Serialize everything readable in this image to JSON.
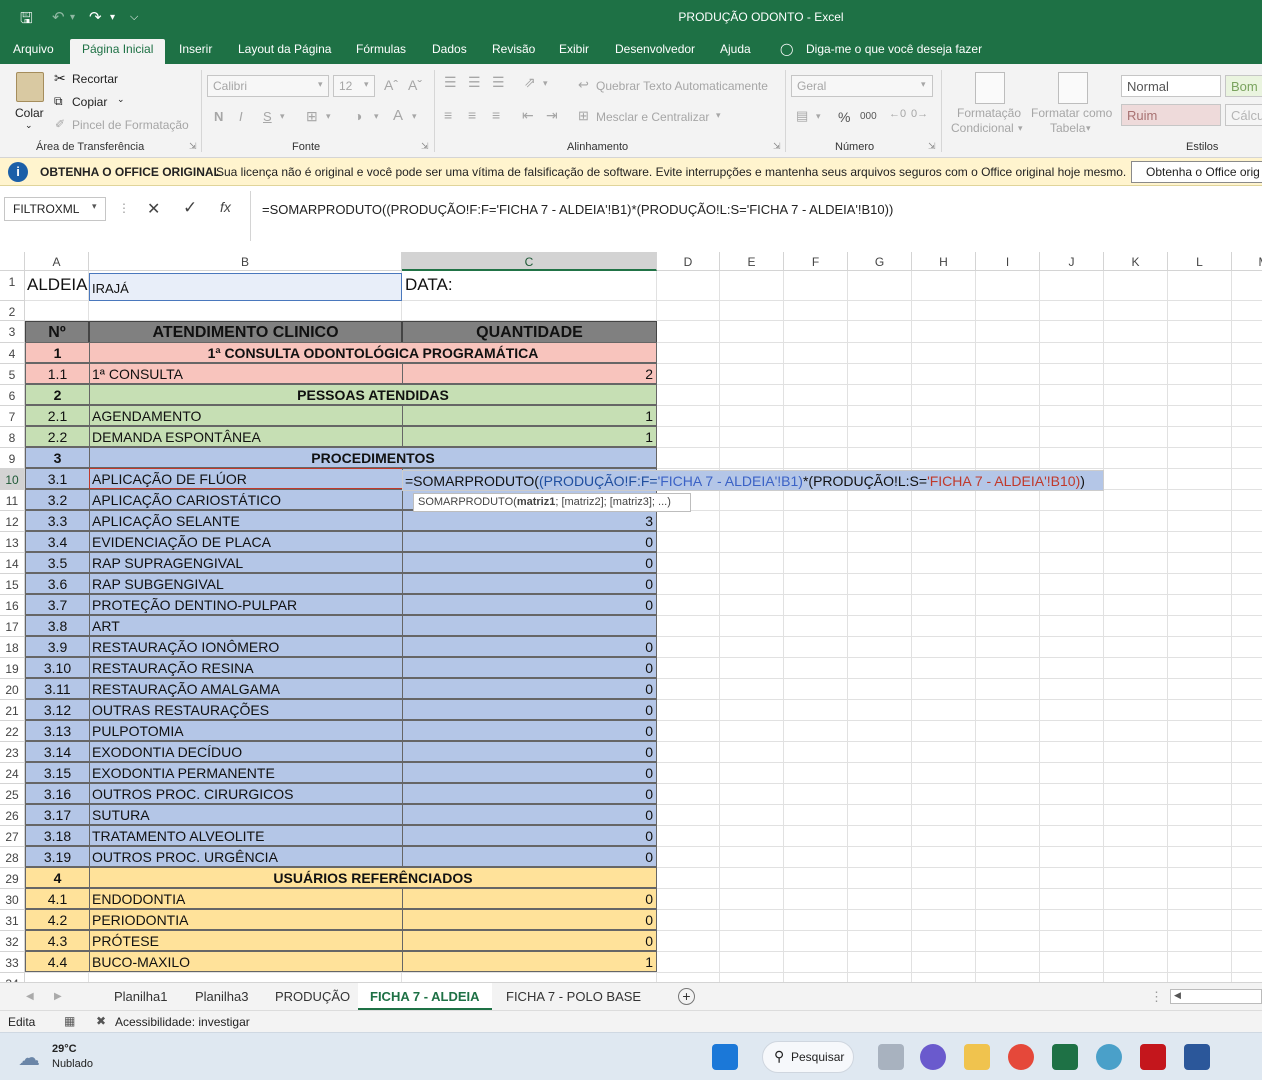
{
  "window": {
    "title": "PRODUÇÃO ODONTO  -  Excel"
  },
  "quick_access": {
    "save_icon": "save-icon",
    "undo_icon": "undo-icon",
    "redo_icon": "redo-icon"
  },
  "menu": {
    "tabs": [
      "Arquivo",
      "Página Inicial",
      "Inserir",
      "Layout da Página",
      "Fórmulas",
      "Dados",
      "Revisão",
      "Exibir",
      "Desenvolvedor",
      "Ajuda"
    ],
    "tell_me": "Diga-me o que você deseja fazer"
  },
  "ribbon": {
    "clipboard": {
      "paste": "Colar",
      "cut": "Recortar",
      "copy": "Copiar",
      "format_painter": "Pincel de Formatação",
      "label": "Área de Transferência"
    },
    "font": {
      "name": "Calibri",
      "size": "12",
      "label": "Fonte",
      "bold": "N",
      "italic": "I",
      "underline": "S"
    },
    "alignment": {
      "wrap": "Quebrar Texto Automaticamente",
      "merge": "Mesclar e Centralizar",
      "label": "Alinhamento"
    },
    "number": {
      "format": "Geral",
      "label": "Número",
      "percent": "%",
      "thousands": "000"
    },
    "styles": {
      "conditional": "Formatação",
      "conditional2": "Condicional",
      "table": "Formatar como",
      "table2": "Tabela",
      "normal": "Normal",
      "bom": "Bom",
      "ruim": "Ruim",
      "calculo": "Cálcu",
      "label": "Estilos"
    }
  },
  "message_bar": {
    "title": "OBTENHA O OFFICE ORIGINAL",
    "text": "Sua licença não é original e você pode ser uma vítima de falsificação de software. Evite interrupções e mantenha seus arquivos seguros com o Office original hoje mesmo.",
    "button": "Obtenha o Office orig"
  },
  "formula_bar": {
    "name_box": "FILTROXML",
    "formula": "=SOMARPRODUTO((PRODUÇÃO!F:F='FICHA 7 - ALDEIA'!B1)*(PRODUÇÃO!L:S='FICHA 7 - ALDEIA'!B10))"
  },
  "columns": [
    "A",
    "B",
    "C",
    "D",
    "E",
    "F",
    "G",
    "H",
    "I",
    "J",
    "K",
    "L",
    "M"
  ],
  "sheet": {
    "r1": {
      "a": "ALDEIA:",
      "b": "IRAJÁ",
      "c": "DATA:"
    },
    "header": {
      "a": "Nº",
      "b": "ATENDIMENTO CLINICO",
      "c": "QUANTIDADE"
    },
    "rows": [
      {
        "n": "4",
        "a": "1",
        "b": "1ª CONSULTA ODONTOLÓGICA PROGRAMÁTICA",
        "c": "",
        "section": true
      },
      {
        "n": "5",
        "a": "1.1",
        "b": "1ª CONSULTA",
        "c": "2"
      },
      {
        "n": "6",
        "a": "2",
        "b": "PESSOAS ATENDIDAS",
        "c": "",
        "section": true
      },
      {
        "n": "7",
        "a": "2.1",
        "b": "AGENDAMENTO",
        "c": "1"
      },
      {
        "n": "8",
        "a": "2.2",
        "b": "DEMANDA ESPONTÂNEA",
        "c": "1"
      },
      {
        "n": "9",
        "a": "3",
        "b": "PROCEDIMENTOS",
        "c": "",
        "section": true
      },
      {
        "n": "10",
        "a": "3.1",
        "b": "APLICAÇÃO DE FLÚOR",
        "c": ""
      },
      {
        "n": "11",
        "a": "3.2",
        "b": "APLICAÇÃO CARIOSTÁTICO",
        "c": ""
      },
      {
        "n": "12",
        "a": "3.3",
        "b": "APLICAÇÃO SELANTE",
        "c": "3"
      },
      {
        "n": "13",
        "a": "3.4",
        "b": "EVIDENCIAÇÃO DE PLACA",
        "c": "0"
      },
      {
        "n": "14",
        "a": "3.5",
        "b": "RAP SUPRAGENGIVAL",
        "c": "0"
      },
      {
        "n": "15",
        "a": "3.6",
        "b": "RAP SUBGENGIVAL",
        "c": "0"
      },
      {
        "n": "16",
        "a": "3.7",
        "b": "PROTEÇÃO DENTINO-PULPAR",
        "c": "0"
      },
      {
        "n": "17",
        "a": "3.8",
        "b": "ART",
        "c": ""
      },
      {
        "n": "18",
        "a": "3.9",
        "b": "RESTAURAÇÃO IONÔMERO",
        "c": "0"
      },
      {
        "n": "19",
        "a": "3.10",
        "b": "RESTAURAÇÃO RESINA",
        "c": "0"
      },
      {
        "n": "20",
        "a": "3.11",
        "b": "RESTAURAÇÃO AMALGAMA",
        "c": "0"
      },
      {
        "n": "21",
        "a": "3.12",
        "b": "OUTRAS RESTAURAÇÕES",
        "c": "0"
      },
      {
        "n": "22",
        "a": "3.13",
        "b": "PULPOTOMIA",
        "c": "0"
      },
      {
        "n": "23",
        "a": "3.14",
        "b": "EXODONTIA DECÍDUO",
        "c": "0"
      },
      {
        "n": "24",
        "a": "3.15",
        "b": "EXODONTIA PERMANENTE",
        "c": "0"
      },
      {
        "n": "25",
        "a": "3.16",
        "b": "OUTROS PROC. CIRURGICOS",
        "c": "0"
      },
      {
        "n": "26",
        "a": "3.17",
        "b": "SUTURA",
        "c": "0"
      },
      {
        "n": "27",
        "a": "3.18",
        "b": "TRATAMENTO ALVEOLITE",
        "c": "0"
      },
      {
        "n": "28",
        "a": "3.19",
        "b": "OUTROS PROC. URGÊNCIA",
        "c": "0"
      },
      {
        "n": "29",
        "a": "4",
        "b": "USUÁRIOS REFERÊNCIADOS",
        "c": "",
        "section": true
      },
      {
        "n": "30",
        "a": "4.1",
        "b": "ENDODONTIA",
        "c": "0"
      },
      {
        "n": "31",
        "a": "4.2",
        "b": "PERIODONTIA",
        "c": "0"
      },
      {
        "n": "32",
        "a": "4.3",
        "b": "PRÓTESE",
        "c": "0"
      },
      {
        "n": "33",
        "a": "4.4",
        "b": "BUCO-MAXILO",
        "c": "1"
      }
    ],
    "edit": {
      "p1": "=SOMARPRODUTO(",
      "p2": "(PRODUÇÃO!F:F=",
      "p3": "'FICHA 7 - ALDEIA'!B1)",
      "p4": "*(PRODUÇÃO!L:S=",
      "p5": "'FICHA 7 - ALDEIA'!B10)",
      ")": ")",
      "tooltip": "SOMARPRODUTO(",
      "tooltip_bold": "matriz1",
      "tooltip_rest": "; [matriz2]; [matriz3]; ...)"
    },
    "colors": {
      "pink": "#f8c4bd",
      "green": "#c6dfb4",
      "blue": "#b4c6e7",
      "yellow": "#ffe29a",
      "header": "#808080"
    }
  },
  "sheet_tabs": [
    "Planilha1",
    "Planilha3",
    "PRODUÇÃO",
    "FICHA 7 - ALDEIA",
    "FICHA 7 - POLO BASE"
  ],
  "active_sheet": "FICHA 7 - ALDEIA",
  "status": {
    "mode": "Edita",
    "accessibility": "Acessibilidade: investigar"
  },
  "taskbar": {
    "temp": "29°C",
    "weather": "Nublado",
    "search": "Pesquisar"
  }
}
